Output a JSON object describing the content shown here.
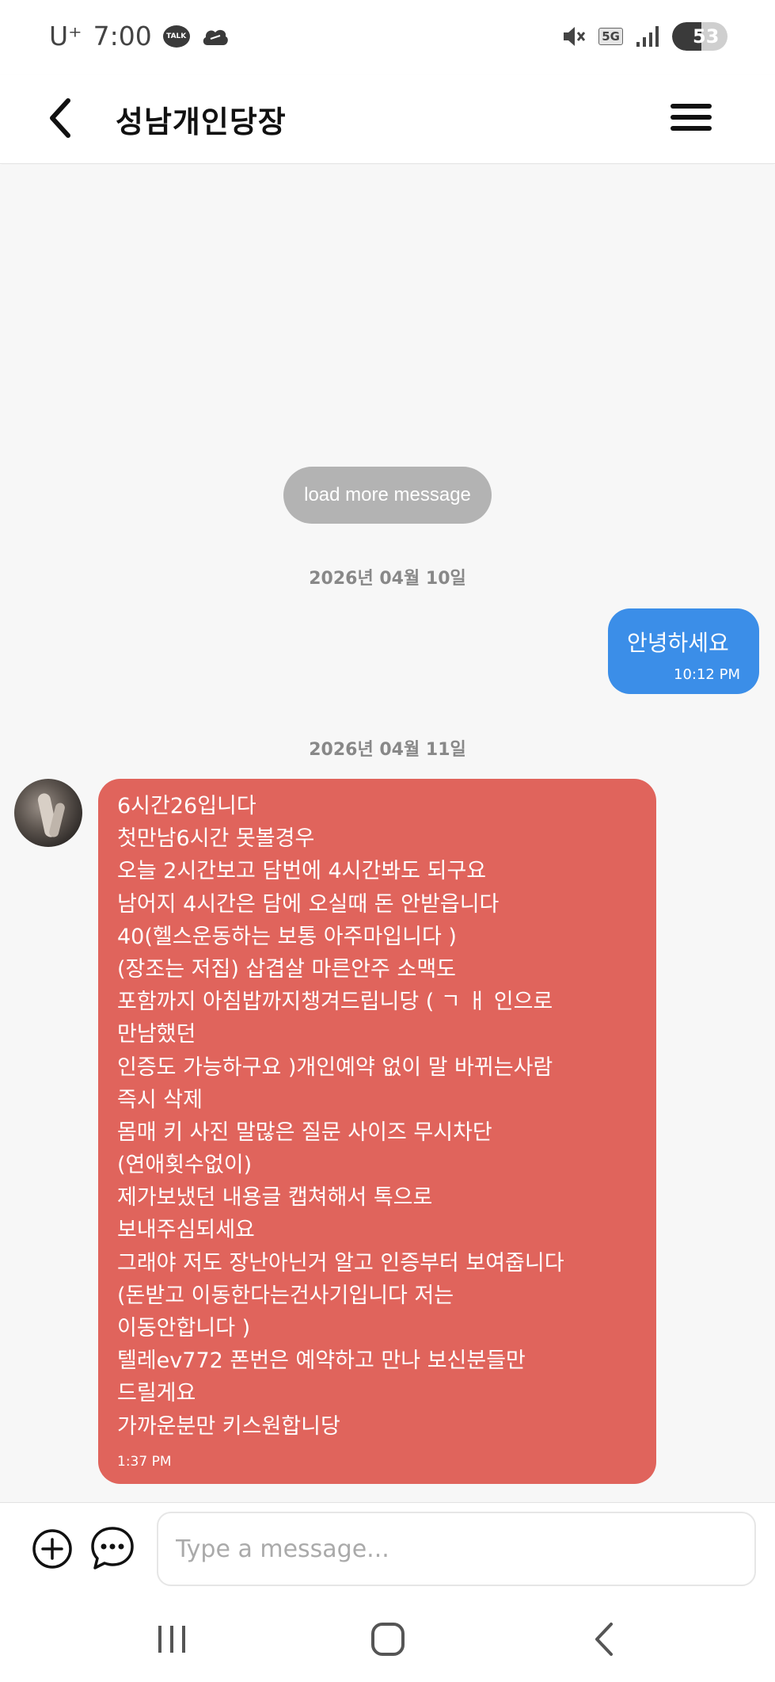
{
  "status_bar": {
    "carrier": "U⁺",
    "time": "7:00",
    "talk_badge": "TALK",
    "network": "5G",
    "battery": "53",
    "battery_level_percent": 53
  },
  "header": {
    "title": "성남개인당장"
  },
  "chat": {
    "load_more_label": "load more message",
    "dates": [
      "2026년 04월 10일",
      "2026년 04월 11일"
    ],
    "outgoing": {
      "text": "안녕하세요",
      "time": "10:12 PM"
    },
    "incoming": {
      "lines": [
        "6시간26입니다",
        "첫만남6시간 못볼경우",
        "오늘 2시간보고 담번에 4시간봐도 되구요",
        "남어지 4시간은 담에 오실때 돈 안받읍니다",
        "40(헬스운동하는 보통 아주마입니다 )",
        "(장조는 저집) 삽겹살 마른안주 소맥도",
        "포함까지 아침밥까지챙겨드립니당 ( ㄱ  ㅐ 인으로",
        "만남했던",
        "인증도 가능하구요 )개인예약 없이 말 바뀌는사람",
        "즉시 삭제",
        "몸매 키 사진 말많은 질문 사이즈 무시차단",
        "(연애횟수없이)",
        "제가보냈던 내용글 캡쳐해서 톡으로",
        "보내주심되세요",
        "그래야 저도 장난아닌거 알고 인증부터 보여줍니다",
        "(돈받고 이동한다는건사기입니다 저는",
        "이동안합니다 )",
        "텔레ev772 폰번은 예약하고 만나 보신분들만",
        "드릴게요",
        "가까운분만 키스원합니당"
      ],
      "time": "1:37 PM"
    }
  },
  "input": {
    "placeholder": "Type a message..."
  },
  "colors": {
    "outgoing_bubble": "#3b8ee8",
    "incoming_bubble": "#e0645c",
    "load_more_bg": "#b3b3b3"
  }
}
